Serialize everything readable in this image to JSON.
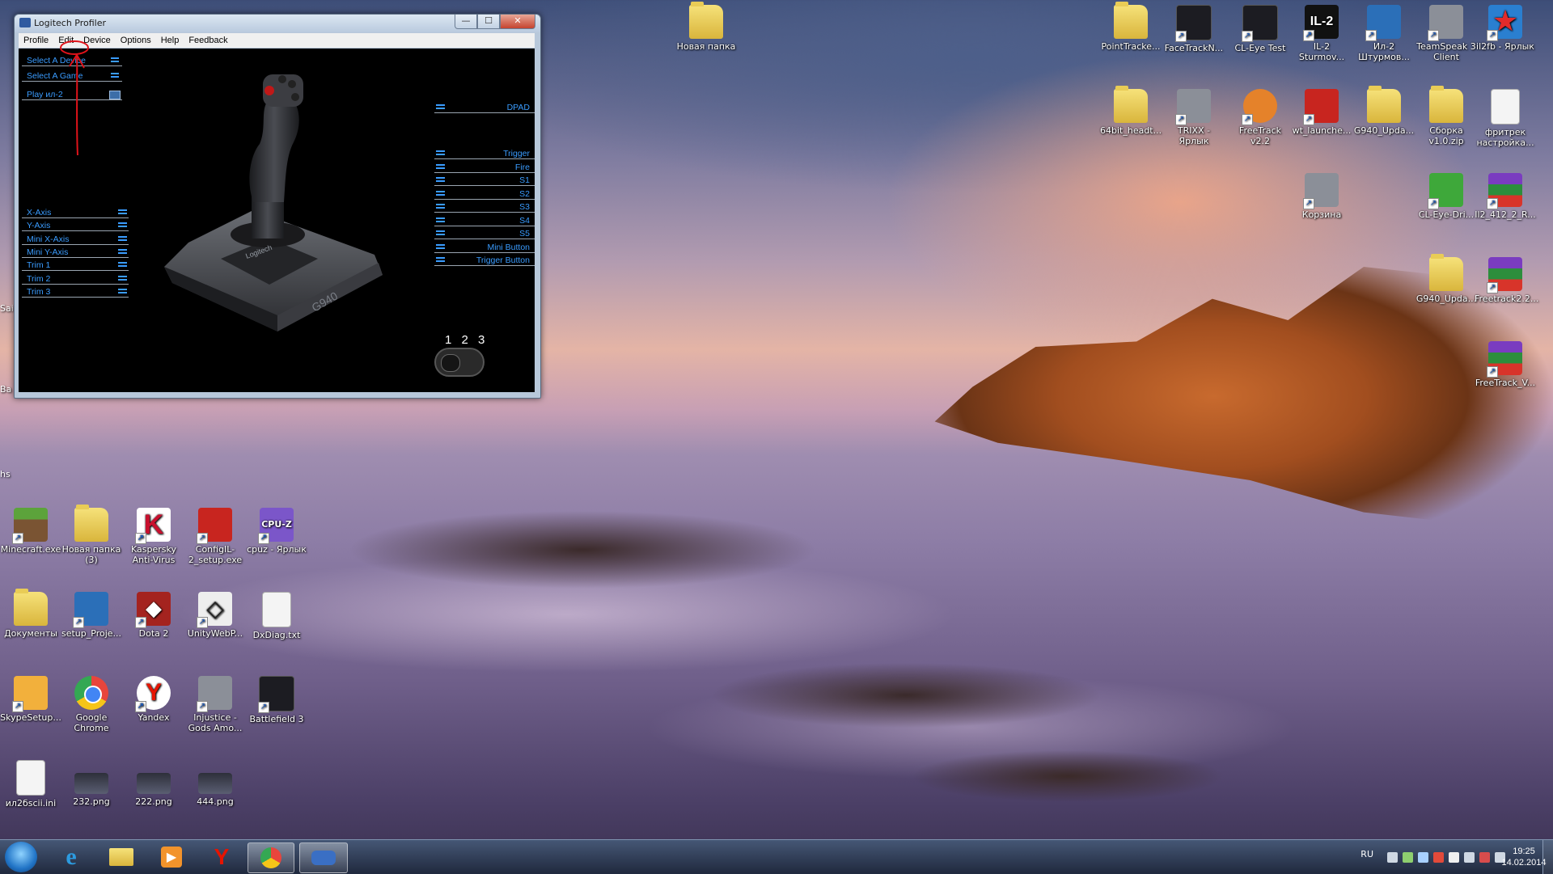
{
  "window": {
    "title": "Logitech Profiler",
    "buttons": {
      "minimize": "—",
      "maximize": "☐",
      "close": "✕"
    },
    "menu": [
      "Profile",
      "Edit",
      "Device",
      "Options",
      "Help",
      "Feedback"
    ]
  },
  "left_panel": {
    "select_device": "Select A Device",
    "select_game": "Select A Game",
    "play": "Play ил-2"
  },
  "axes": [
    "X-Axis",
    "Y-Axis",
    "Mini X-Axis",
    "Mini Y-Axis",
    "Trim 1",
    "Trim 2",
    "Trim 3"
  ],
  "buttons_right": [
    "DPAD",
    "Trigger",
    "Fire",
    "S1",
    "S2",
    "S3",
    "S4",
    "S5",
    "Mini Button",
    "Trigger Button"
  ],
  "device": {
    "brand": "Logitech",
    "model": "G940"
  },
  "modes": "1 2 3",
  "desktop_icons_right": [
    {
      "label": "PointTracke...",
      "icon": "folder"
    },
    {
      "label": "FaceTrackN...",
      "icon": "dark"
    },
    {
      "label": "CL-Eye Test",
      "icon": "dark"
    },
    {
      "label": "IL-2 Sturmov...",
      "icon": "il2"
    },
    {
      "label": "Ил-2 Штурмов...",
      "icon": "blue"
    },
    {
      "label": "TeamSpeak 3 Client",
      "icon": "gray"
    },
    {
      "label": "il2fb - Ярлык",
      "icon": "star"
    },
    {
      "label": "64bit_headt...",
      "icon": "folder"
    },
    {
      "label": "TRIXX - Ярлык",
      "icon": "gray"
    },
    {
      "label": "FreeTrack v2.2",
      "icon": "orange"
    },
    {
      "label": "wt_launche...",
      "icon": "red"
    },
    {
      "label": "G940_Upda...",
      "icon": "folder"
    },
    {
      "label": "Сборка v1.0.zip",
      "icon": "folder"
    },
    {
      "label": "фритрек настройка...",
      "icon": "file"
    },
    {
      "label": "Корзина",
      "icon": "gray"
    },
    {
      "label": "CL-Eye-Dri...",
      "icon": "green"
    },
    {
      "label": "Il2_412_2_R...",
      "icon": "winrar"
    },
    {
      "label": "G940_Upda...",
      "icon": "folder"
    },
    {
      "label": "Freetrack2.2...",
      "icon": "winrar"
    },
    {
      "label": "FreeTrack_V...",
      "icon": "winrar"
    }
  ],
  "desktop_icon_top": {
    "label": "Новая папка",
    "icon": "folder"
  },
  "desktop_icons_left": [
    {
      "label": "Minecraft.exe",
      "icon": "mc"
    },
    {
      "label": "Новая папка (3)",
      "icon": "folder"
    },
    {
      "label": "Kaspersky Anti-Virus",
      "icon": "k"
    },
    {
      "label": "ConfigIL-2_setup.exe",
      "icon": "red"
    },
    {
      "label": "cpuz - Ярлык",
      "icon": "cpu"
    },
    {
      "label": "Документы",
      "icon": "folder"
    },
    {
      "label": "setup_Proje...",
      "icon": "blue"
    },
    {
      "label": "Dota 2",
      "icon": "dota"
    },
    {
      "label": "UnityWebP...",
      "icon": "unity"
    },
    {
      "label": "DxDiag.txt",
      "icon": "file"
    },
    {
      "label": "SkypeSetup...",
      "icon": "skype"
    },
    {
      "label": "Google Chrome",
      "icon": "chrome"
    },
    {
      "label": "Yandex",
      "icon": "y"
    },
    {
      "label": "Injustice - Gods Amo...",
      "icon": "gray"
    },
    {
      "label": "Battlefield 3",
      "icon": "dark"
    },
    {
      "label": "ил2бscii.ini",
      "icon": "file"
    },
    {
      "label": "232.png",
      "icon": "png"
    },
    {
      "label": "222.png",
      "icon": "png"
    },
    {
      "label": "444.png",
      "icon": "png"
    }
  ],
  "edge_labels": [
    "Sai",
    "Ba",
    "hs"
  ],
  "taskbar": {
    "apps": [
      "internet-explorer",
      "explorer",
      "media-player",
      "yandex",
      "chrome",
      "logitech-profiler"
    ],
    "lang": "RU",
    "time": "19:25",
    "date": "14.02.2014"
  },
  "colors": {
    "accent": "#3a9cff",
    "annotation": "#e0131a"
  }
}
